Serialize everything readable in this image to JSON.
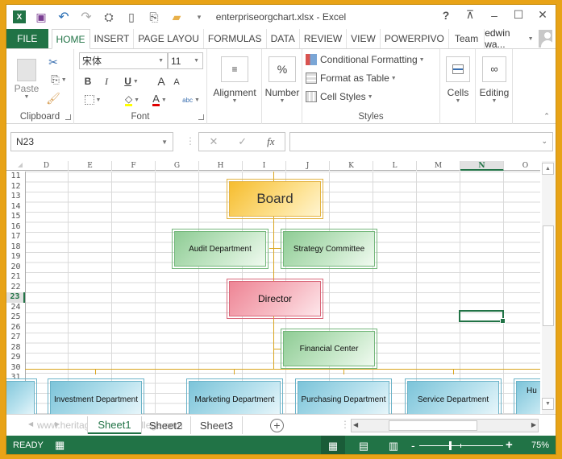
{
  "window": {
    "title": "enterpriseorgchart.xlsx - Excel",
    "help": "?",
    "controls": [
      "ribbon-display-options",
      "minimize",
      "maximize",
      "close"
    ]
  },
  "qat": {
    "icons": [
      "excel-logo-icon",
      "save-icon",
      "undo-icon",
      "redo-icon",
      "touch-mode-icon",
      "new-file-icon",
      "attach-icon",
      "open-folder-icon",
      "customize-qat-icon"
    ]
  },
  "tabs": [
    {
      "label": "FILE"
    },
    {
      "label": "HOME"
    },
    {
      "label": "INSERT"
    },
    {
      "label": "PAGE LAYOU"
    },
    {
      "label": "FORMULAS"
    },
    {
      "label": "DATA"
    },
    {
      "label": "REVIEW"
    },
    {
      "label": "VIEW"
    },
    {
      "label": "POWERPIVO"
    },
    {
      "label": "Team"
    }
  ],
  "user": {
    "name": "edwin wa..."
  },
  "ribbon": {
    "clipboard": {
      "label": "Clipboard",
      "paste": "Paste"
    },
    "font": {
      "label": "Font",
      "name": "宋体",
      "size": "11",
      "bold": "B",
      "italic": "I",
      "underline": "U",
      "grow": "A",
      "shrink": "A",
      "fill_color": "#ffff00",
      "font_color": "#e00000",
      "abc": "abc"
    },
    "alignment": {
      "label": "Alignment"
    },
    "number": {
      "label": "Number",
      "icon": "%"
    },
    "styles": {
      "label": "Styles",
      "conditional": "Conditional Formatting",
      "format_table": "Format as Table",
      "cell_styles": "Cell Styles"
    },
    "cells": {
      "label": "Cells"
    },
    "editing": {
      "label": "Editing"
    }
  },
  "formula_bar": {
    "name_box": "N23",
    "cancel": "✕",
    "enter": "✓",
    "fx": "fx",
    "value": ""
  },
  "grid": {
    "columns": [
      "D",
      "E",
      "F",
      "G",
      "H",
      "I",
      "J",
      "K",
      "L",
      "M",
      "N",
      "O"
    ],
    "selected_column": "N",
    "rows": [
      "11",
      "12",
      "13",
      "14",
      "15",
      "16",
      "17",
      "18",
      "19",
      "20",
      "21",
      "22",
      "23",
      "24",
      "25",
      "26",
      "27",
      "28",
      "29",
      "30",
      "31"
    ],
    "selected_row": "23",
    "selected_cell": "N23"
  },
  "org_chart": {
    "board": "Board",
    "audit": "Audit Department",
    "strategy": "Strategy Committee",
    "director": "Director",
    "financial": "Financial Center",
    "departments": [
      "",
      "Investment Department",
      "Marketing Department",
      "Purchasing Department",
      "Service Department",
      "Hu"
    ]
  },
  "sheet_tabs": {
    "tabs": [
      "Sheet1",
      "Sheet2",
      "Sheet3"
    ],
    "active": "Sheet1",
    "watermark": "www.heritagechristiancollege.com"
  },
  "status_bar": {
    "mode": "READY",
    "zoom": "75%",
    "zoom_percent": 75,
    "minus": "-",
    "plus": "+"
  }
}
